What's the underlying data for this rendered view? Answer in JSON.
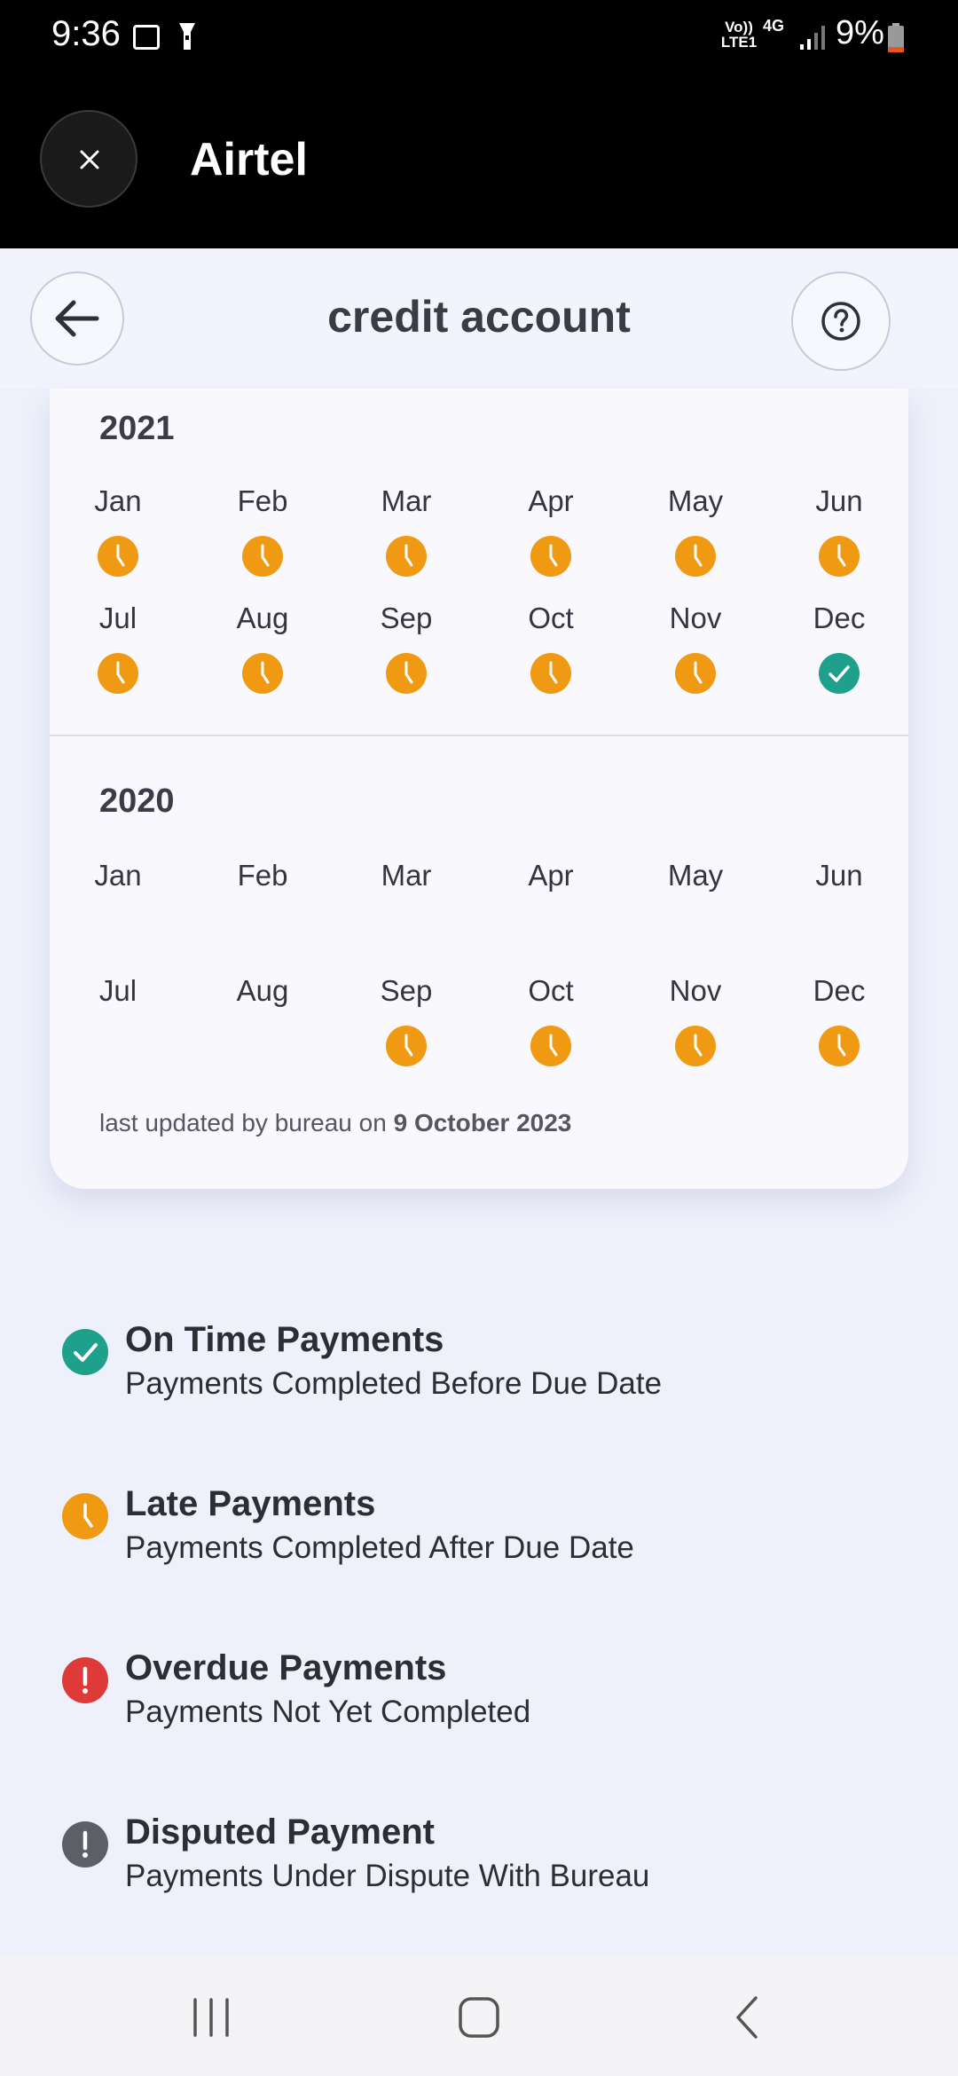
{
  "status_bar": {
    "time": "9:36",
    "network_label": "Vo)) LTE1",
    "network_type": "4G",
    "battery": "9%"
  },
  "app_header": {
    "title": "Airtel"
  },
  "page_header": {
    "title": "credit account"
  },
  "years": [
    {
      "year": "2021",
      "months": [
        {
          "label": "Jan",
          "status": "late"
        },
        {
          "label": "Feb",
          "status": "late"
        },
        {
          "label": "Mar",
          "status": "late"
        },
        {
          "label": "Apr",
          "status": "late"
        },
        {
          "label": "May",
          "status": "late"
        },
        {
          "label": "Jun",
          "status": "late"
        },
        {
          "label": "Jul",
          "status": "late"
        },
        {
          "label": "Aug",
          "status": "late"
        },
        {
          "label": "Sep",
          "status": "late"
        },
        {
          "label": "Oct",
          "status": "late"
        },
        {
          "label": "Nov",
          "status": "late"
        },
        {
          "label": "Dec",
          "status": "on_time"
        }
      ]
    },
    {
      "year": "2020",
      "months": [
        {
          "label": "Jan",
          "status": "none"
        },
        {
          "label": "Feb",
          "status": "none"
        },
        {
          "label": "Mar",
          "status": "none"
        },
        {
          "label": "Apr",
          "status": "none"
        },
        {
          "label": "May",
          "status": "none"
        },
        {
          "label": "Jun",
          "status": "none"
        },
        {
          "label": "Jul",
          "status": "none"
        },
        {
          "label": "Aug",
          "status": "none"
        },
        {
          "label": "Sep",
          "status": "late"
        },
        {
          "label": "Oct",
          "status": "late"
        },
        {
          "label": "Nov",
          "status": "late"
        },
        {
          "label": "Dec",
          "status": "late"
        }
      ]
    }
  ],
  "last_updated": {
    "prefix": "last updated by bureau on",
    "date": "9 October 2023"
  },
  "legend": [
    {
      "icon": "check-icon",
      "color": "#1fa08c",
      "title": "On Time Payments",
      "desc": "Payments Completed Before Due Date"
    },
    {
      "icon": "clock-icon",
      "color": "#ef9a12",
      "title": "Late Payments",
      "desc": "Payments Completed After Due Date"
    },
    {
      "icon": "exclamation-icon",
      "color": "#df3a3a",
      "title": "Overdue Payments",
      "desc": "Payments Not Yet Completed"
    },
    {
      "icon": "exclamation-icon",
      "color": "#5e5f66",
      "title": "Disputed Payment",
      "desc": "Payments Under Dispute With Bureau"
    }
  ],
  "colors": {
    "late": "#ef9a12",
    "on_time": "#1fa08c",
    "overdue": "#df3a3a",
    "disputed": "#5e5f66"
  }
}
